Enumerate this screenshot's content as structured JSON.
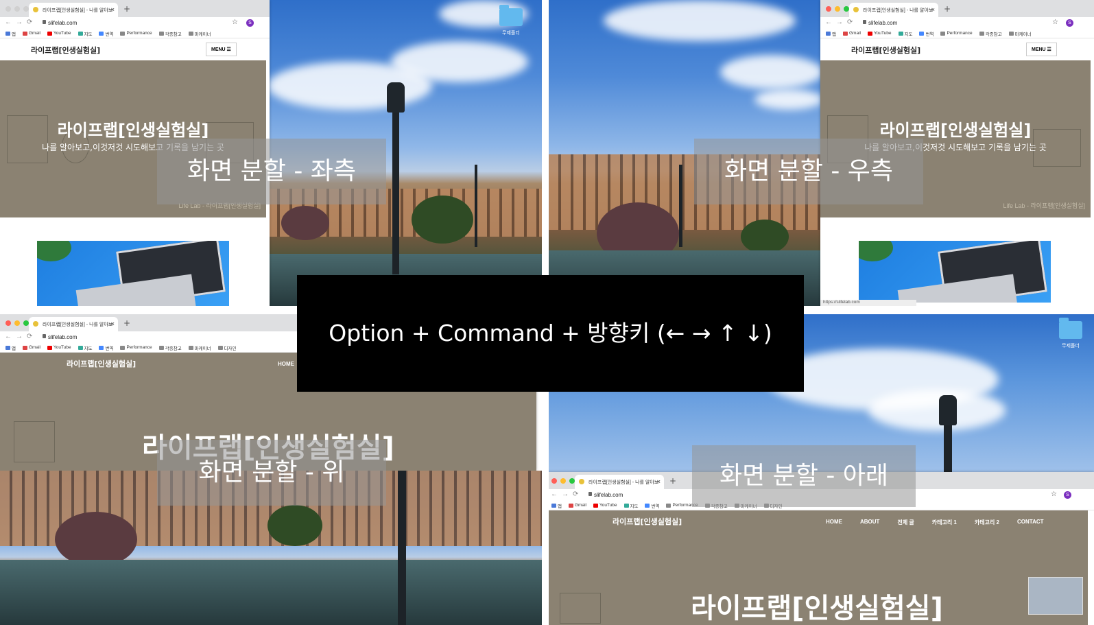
{
  "center_shortcut": "Option + Command + 방향키 (← → ↑ ↓)",
  "labels": {
    "left": "화면 분할 - 좌측",
    "right": "화면 분할 - 우측",
    "top": "화면 분할 - 위",
    "bottom": "화면 분할 - 아래"
  },
  "desktop": {
    "folder_label": "무제폴더"
  },
  "browser": {
    "tab_title": "라이프랩[인생실험실] - 나를 알아보",
    "url": "slifelab.com",
    "avatar_letter": "S",
    "status_url": "https://slifelab.com",
    "bookmarks": [
      "앱",
      "Gmail",
      "YouTube",
      "지도",
      "번역",
      "Performance",
      "각종참고",
      "마케이너",
      "디자인"
    ]
  },
  "site": {
    "logo": "라이프랩[인생실험실]",
    "menu_label": "MENU ☰",
    "hero_title": "라이프랩[인생실험실]",
    "hero_subtitle": "나를 알아보고,이것저것 시도해보고 기록을 남기는 곳",
    "hero_footer": "Life Lab - 라이프랩[인생실험실]",
    "nav": [
      "HOME",
      "ABOUT",
      "전체 글",
      "카테고리 1",
      "카테고리 2",
      "CONTACT"
    ]
  },
  "colors": {
    "hero_bg": "#8b8272",
    "center_box": "#000000",
    "overlay_label": "rgba(150,150,150,0.55)",
    "sky": "#2f6fc9",
    "folder": "#62b9ee"
  }
}
